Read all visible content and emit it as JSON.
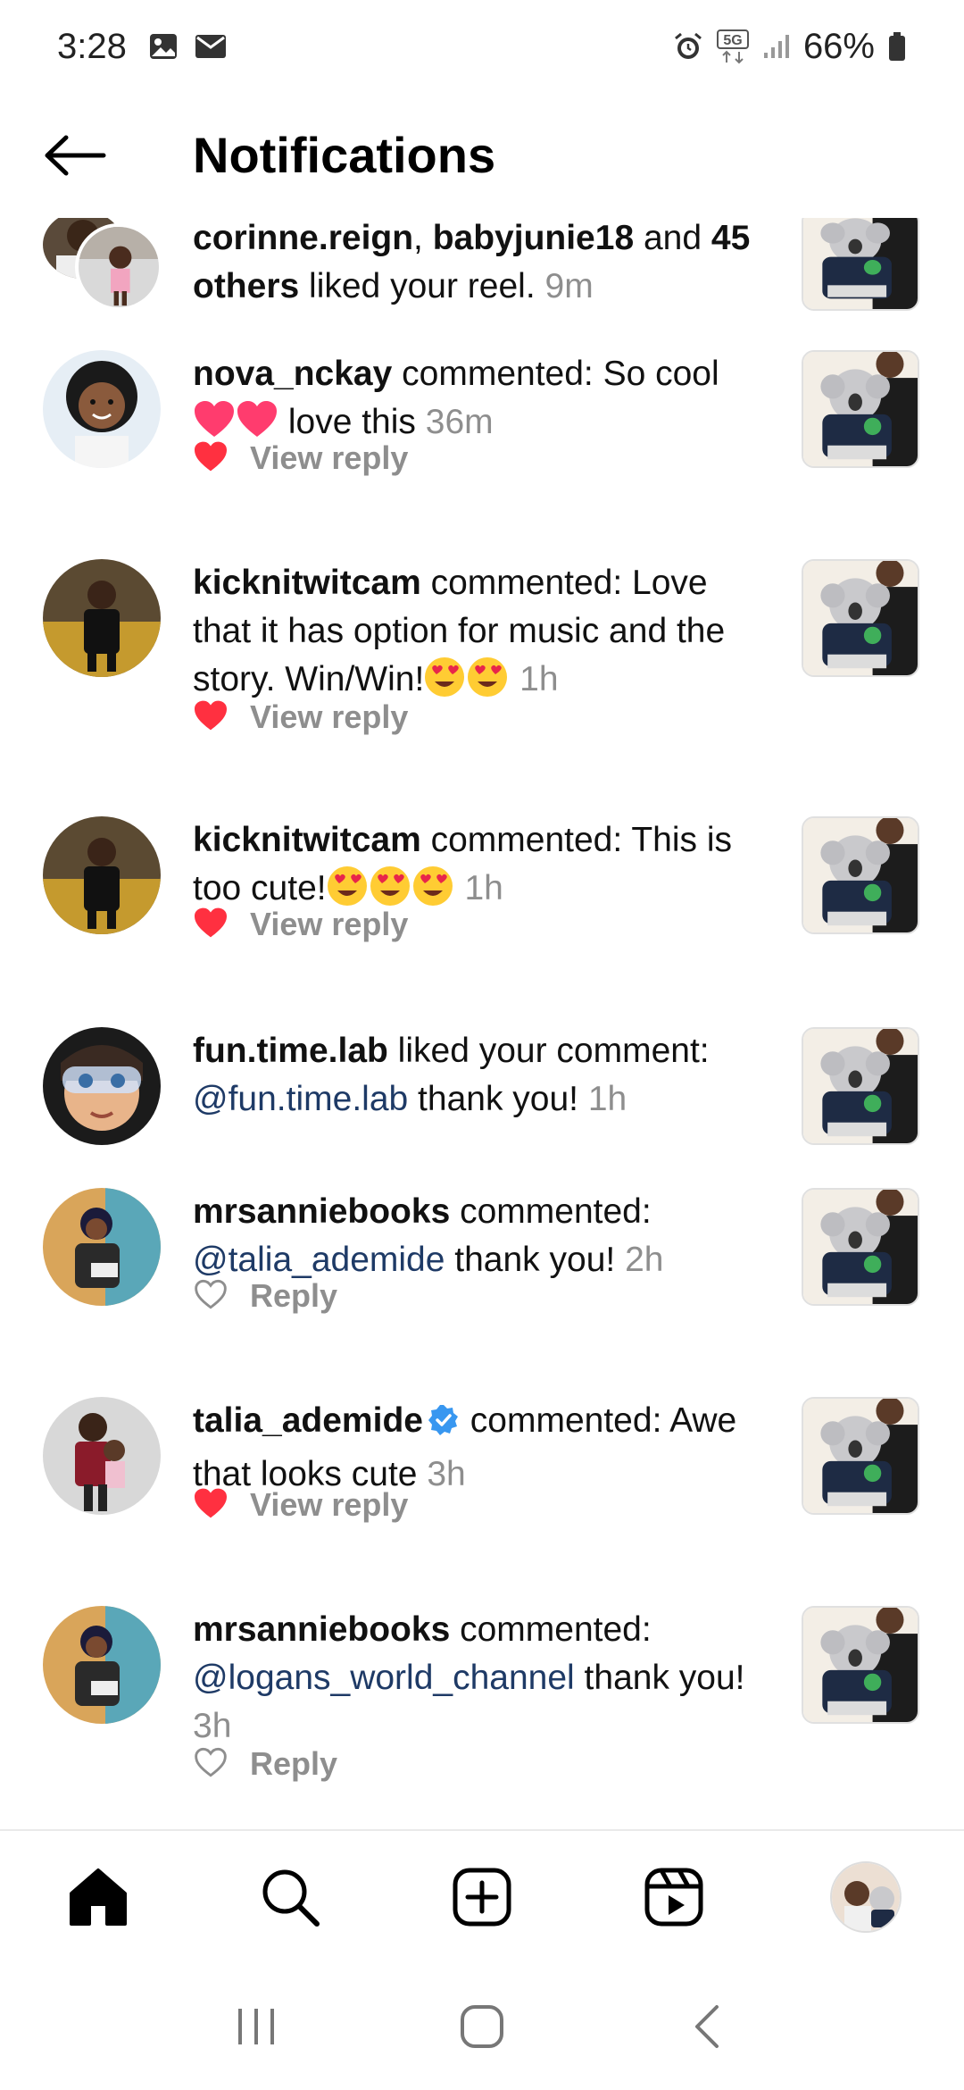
{
  "status_bar": {
    "time": "3:28",
    "battery": "66%",
    "network": "5G",
    "icons": [
      "gallery-icon",
      "email-icon",
      "alarm-icon",
      "5g-icon",
      "signal-icon",
      "battery-icon"
    ]
  },
  "header": {
    "title": "Notifications",
    "back_icon": "arrow-left-icon"
  },
  "notifications": [
    {
      "users": [
        "corinne.reign",
        "babyjunie18"
      ],
      "sep": ", ",
      "and": " and ",
      "others": "45 others",
      "text": " liked your reel. ",
      "time": "9m"
    },
    {
      "user": "nova_nckay",
      "text_a": " commented: So cool ",
      "text_b": " love this ",
      "time": "36m",
      "action": "View reply"
    },
    {
      "user": "kicknitwitcam",
      "text_a": " commented: Love that it has option for music and the story. Win/Win!",
      "time": "1h",
      "action": "View reply"
    },
    {
      "user": "kicknitwitcam",
      "text_a": " commented: This is too cute!",
      "time": "1h",
      "action": "View reply"
    },
    {
      "user": "fun.time.lab",
      "text_a": " liked your comment: ",
      "mention": "@fun.time.lab",
      "text_b": " thank you! ",
      "time": "1h"
    },
    {
      "user": "mrsanniebooks",
      "text_a": " commented: ",
      "mention": "@talia_ademide",
      "text_b": " thank you! ",
      "time": "2h",
      "action": "Reply"
    },
    {
      "user": "talia_ademide",
      "verified": true,
      "text_a": " commented: Awe that looks cute ",
      "time": "3h",
      "action": "View reply"
    },
    {
      "user": "mrsanniebooks",
      "text_a": " commented: ",
      "mention": "@logans_world_channel",
      "text_b": " thank you! ",
      "time": "3h",
      "action": "Reply"
    }
  ],
  "bottom_nav": [
    "home-icon",
    "search-icon",
    "create-icon",
    "reels-icon",
    "profile-avatar"
  ],
  "system_nav": [
    "recent-apps-icon",
    "home-circle-icon",
    "back-chevron-icon"
  ],
  "colors": {
    "heart_red": "#ff3040",
    "mention_blue": "#1e3a66",
    "timestamp_gray": "#8e8e8e"
  }
}
